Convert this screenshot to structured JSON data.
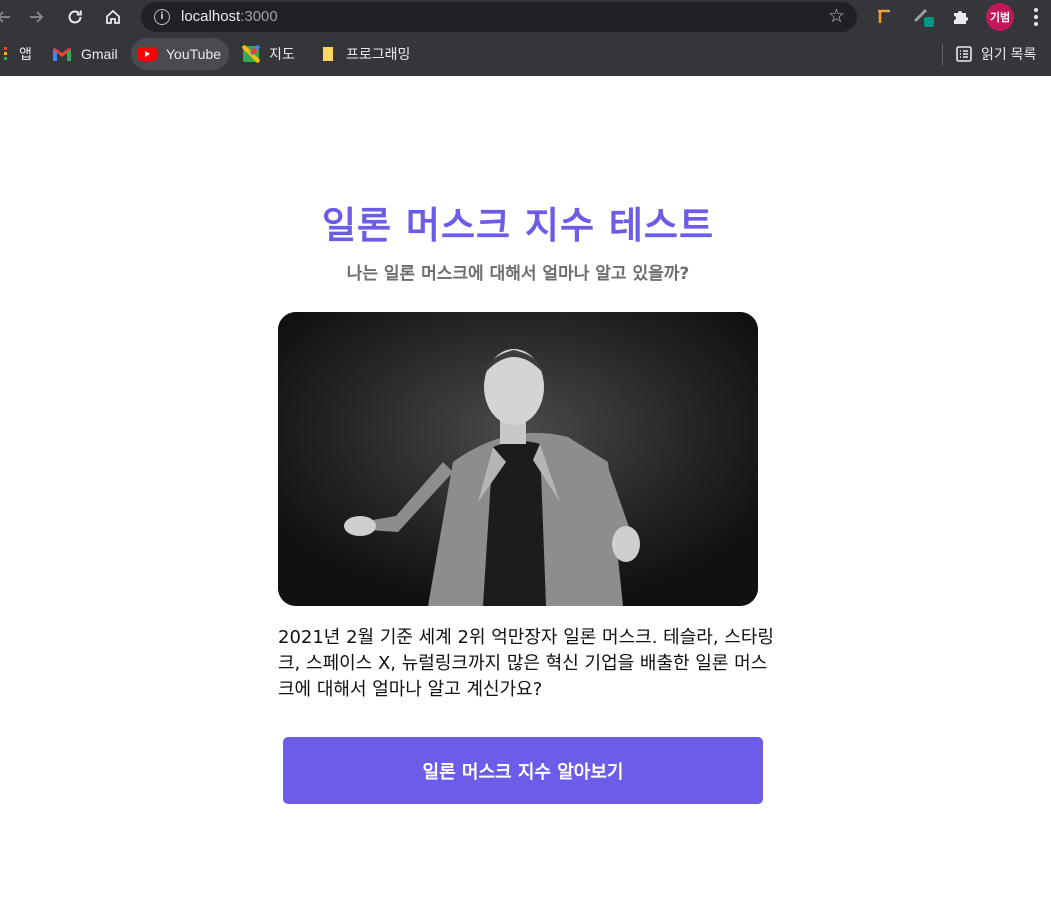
{
  "browser": {
    "url_host": "localhost",
    "url_port": ":3000",
    "profile_initials": "기범",
    "bookmarks": [
      {
        "label": "앱",
        "icon": "apps-grid-icon"
      },
      {
        "label": "Gmail",
        "icon": "gmail-icon"
      },
      {
        "label": "YouTube",
        "icon": "youtube-icon"
      },
      {
        "label": "지도",
        "icon": "maps-icon"
      },
      {
        "label": "프로그래밍",
        "icon": "folder-icon"
      }
    ],
    "reading_list_label": "읽기 목록"
  },
  "page": {
    "title": "일론 머스크 지수 테스트",
    "subtitle": "나는 일론 머스크에 대해서 얼마나 알고 있을까?",
    "description": "2021년 2월 기준 세계 2위 억만장자 일론 머스크. 테슬라, 스타링크, 스페이스 X, 뉴럴링크까지 많은 혁신 기업을 배출한 일론 머스크에 대해서 얼마나 알고 계신가요?",
    "cta_label": "일론 머스크 지수 알아보기"
  },
  "colors": {
    "accent": "#6c5ce7",
    "subtitle": "#6e6e6e",
    "chrome_bg": "#35363a",
    "omnibox_bg": "#202124"
  }
}
